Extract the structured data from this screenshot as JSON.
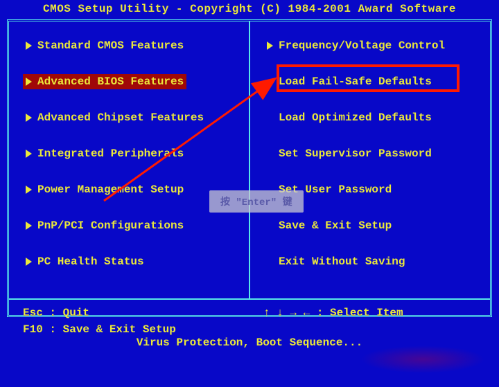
{
  "header": "CMOS Setup Utility - Copyright (C) 1984-2001 Award Software",
  "left_menu": [
    {
      "label": "Standard CMOS Features",
      "tri": true,
      "selected": false
    },
    {
      "label": "Advanced BIOS Features",
      "tri": true,
      "selected": true
    },
    {
      "label": "Advanced Chipset Features",
      "tri": true,
      "selected": false
    },
    {
      "label": "Integrated Peripherals",
      "tri": true,
      "selected": false
    },
    {
      "label": "Power Management Setup",
      "tri": true,
      "selected": false
    },
    {
      "label": "PnP/PCI Configurations",
      "tri": true,
      "selected": false
    },
    {
      "label": "PC Health Status",
      "tri": true,
      "selected": false
    }
  ],
  "right_menu": [
    {
      "label": "Frequency/Voltage Control",
      "tri": true
    },
    {
      "label": "Load Fail-Safe Defaults",
      "tri": false
    },
    {
      "label": "Load Optimized Defaults",
      "tri": false
    },
    {
      "label": "Set Supervisor Password",
      "tri": false
    },
    {
      "label": "Set User Password",
      "tri": false
    },
    {
      "label": "Save & Exit Setup",
      "tri": false
    },
    {
      "label": "Exit Without Saving",
      "tri": false
    }
  ],
  "help": {
    "esc": "Esc : Quit",
    "f10": "F10 : Save & Exit Setup",
    "select": "↑ ↓ → ←   : Select Item"
  },
  "tooltip": "按 \"Enter\" 键",
  "footer": "Virus Protection, Boot Sequence..."
}
